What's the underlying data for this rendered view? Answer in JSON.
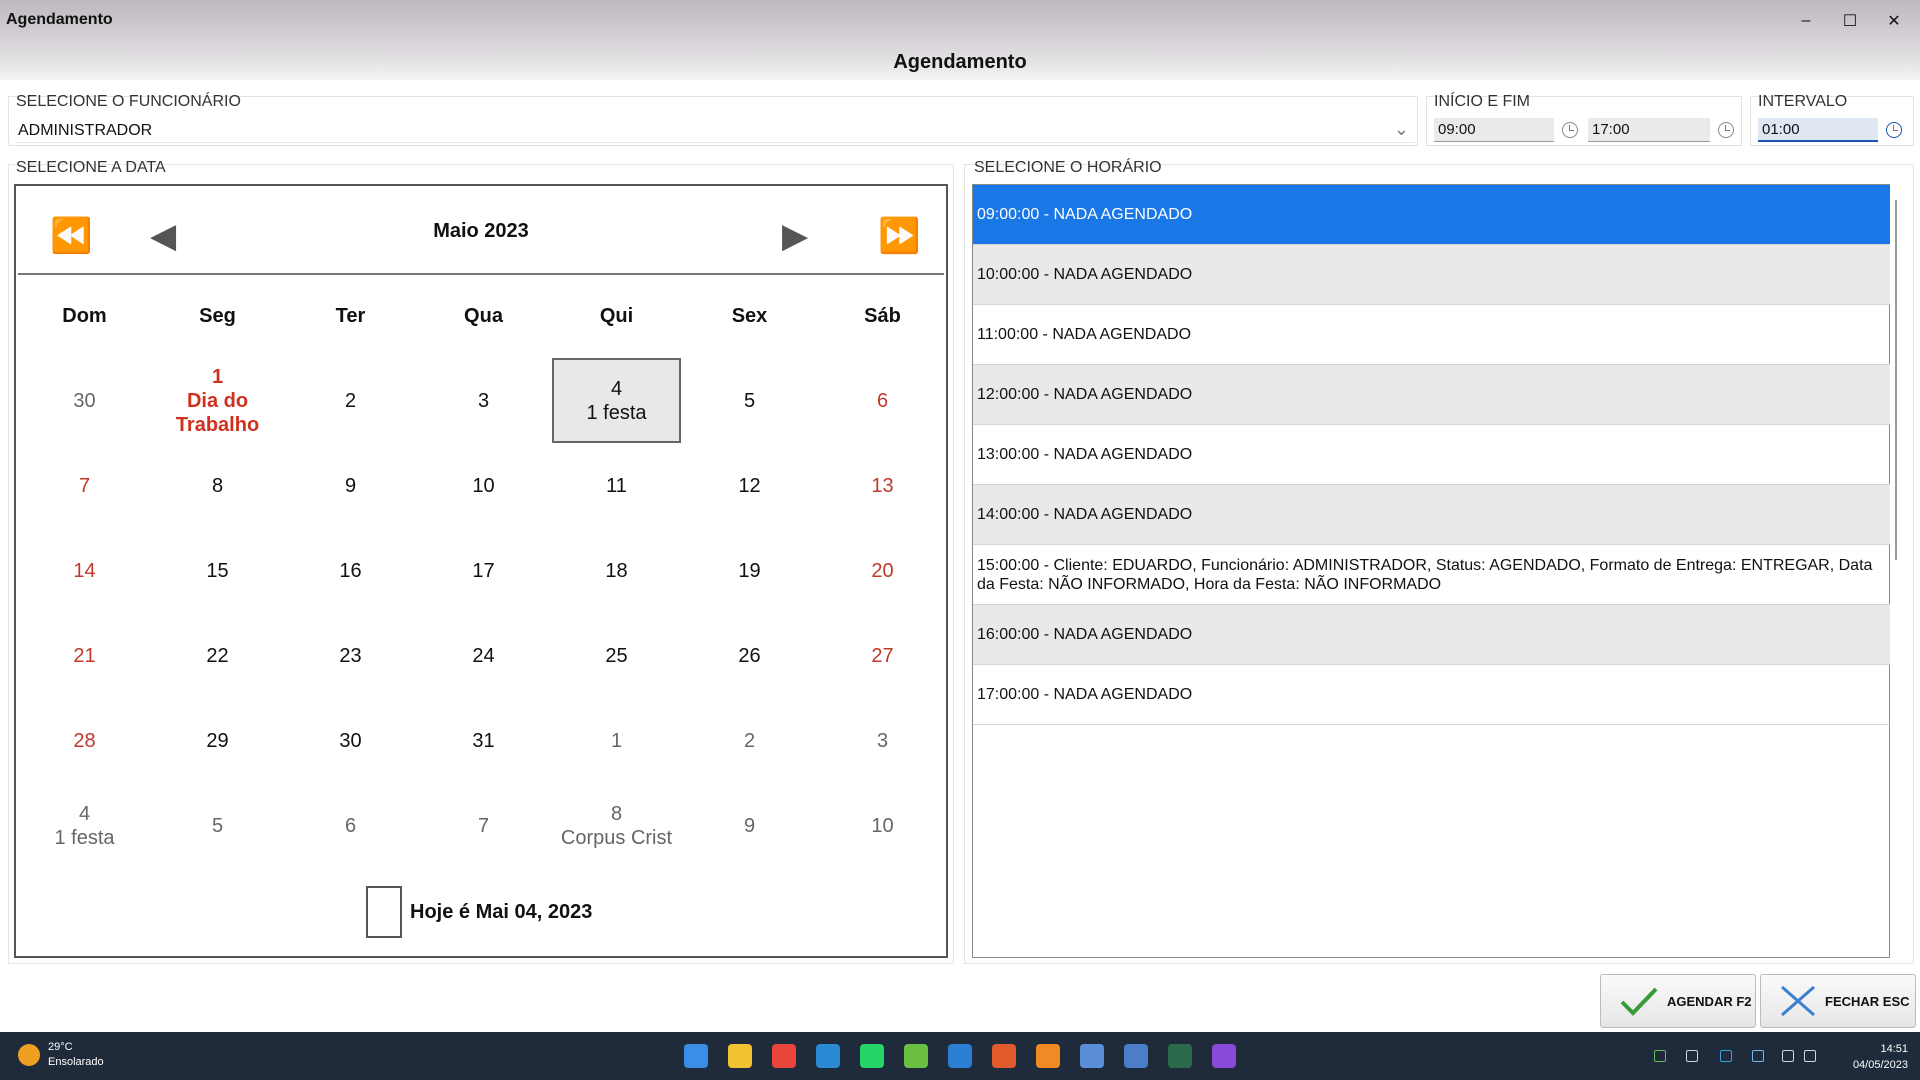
{
  "window": {
    "title": "Agendamento",
    "header_title": "Agendamento",
    "minimize_glyph": "–",
    "maximize_glyph": "☐",
    "close_glyph": "✕"
  },
  "employee": {
    "label": "SELECIONE O FUNCIONÁRIO",
    "value": "ADMINISTRADOR"
  },
  "start_end": {
    "label": "INÍCIO E FIM",
    "start": "09:00",
    "end": "17:00"
  },
  "interval": {
    "label": "INTERVALO",
    "value": "01:00"
  },
  "date_section": {
    "label": "SELECIONE A DATA"
  },
  "hour_section": {
    "label": "SELECIONE O HORÁRIO"
  },
  "calendar": {
    "month_title": "Maio 2023",
    "nav": {
      "prev_year": "⏪",
      "prev_month": "◀",
      "next_month": "▶",
      "next_year": "⏩"
    },
    "weekdays": [
      "Dom",
      "Seg",
      "Ter",
      "Qua",
      "Qui",
      "Sex",
      "Sáb"
    ],
    "weeks": [
      [
        {
          "day": "30",
          "note": "",
          "kind": "other"
        },
        {
          "day": "1",
          "note": "Dia do Trabalho",
          "kind": "holiday"
        },
        {
          "day": "2",
          "note": "",
          "kind": "normal"
        },
        {
          "day": "3",
          "note": "",
          "kind": "normal"
        },
        {
          "day": "4",
          "note": "1 festa",
          "kind": "selected"
        },
        {
          "day": "5",
          "note": "",
          "kind": "normal"
        },
        {
          "day": "6",
          "note": "",
          "kind": "red"
        }
      ],
      [
        {
          "day": "7",
          "note": "",
          "kind": "red"
        },
        {
          "day": "8",
          "note": "",
          "kind": "normal"
        },
        {
          "day": "9",
          "note": "",
          "kind": "normal"
        },
        {
          "day": "10",
          "note": "",
          "kind": "normal"
        },
        {
          "day": "11",
          "note": "",
          "kind": "normal"
        },
        {
          "day": "12",
          "note": "",
          "kind": "normal"
        },
        {
          "day": "13",
          "note": "",
          "kind": "red"
        }
      ],
      [
        {
          "day": "14",
          "note": "",
          "kind": "red"
        },
        {
          "day": "15",
          "note": "",
          "kind": "normal"
        },
        {
          "day": "16",
          "note": "",
          "kind": "normal"
        },
        {
          "day": "17",
          "note": "",
          "kind": "normal"
        },
        {
          "day": "18",
          "note": "",
          "kind": "normal"
        },
        {
          "day": "19",
          "note": "",
          "kind": "normal"
        },
        {
          "day": "20",
          "note": "",
          "kind": "red"
        }
      ],
      [
        {
          "day": "21",
          "note": "",
          "kind": "red"
        },
        {
          "day": "22",
          "note": "",
          "kind": "normal"
        },
        {
          "day": "23",
          "note": "",
          "kind": "normal"
        },
        {
          "day": "24",
          "note": "",
          "kind": "normal"
        },
        {
          "day": "25",
          "note": "",
          "kind": "normal"
        },
        {
          "day": "26",
          "note": "",
          "kind": "normal"
        },
        {
          "day": "27",
          "note": "",
          "kind": "red"
        }
      ],
      [
        {
          "day": "28",
          "note": "",
          "kind": "red"
        },
        {
          "day": "29",
          "note": "",
          "kind": "normal"
        },
        {
          "day": "30",
          "note": "",
          "kind": "normal"
        },
        {
          "day": "31",
          "note": "",
          "kind": "normal"
        },
        {
          "day": "1",
          "note": "",
          "kind": "other"
        },
        {
          "day": "2",
          "note": "",
          "kind": "other"
        },
        {
          "day": "3",
          "note": "",
          "kind": "other"
        }
      ],
      [
        {
          "day": "4",
          "note": "1 festa",
          "kind": "other"
        },
        {
          "day": "5",
          "note": "",
          "kind": "other"
        },
        {
          "day": "6",
          "note": "",
          "kind": "other"
        },
        {
          "day": "7",
          "note": "",
          "kind": "other"
        },
        {
          "day": "8",
          "note": "Corpus Crist",
          "kind": "other"
        },
        {
          "day": "9",
          "note": "",
          "kind": "other"
        },
        {
          "day": "10",
          "note": "",
          "kind": "other"
        }
      ]
    ],
    "today_text": "Hoje é Mai 04, 2023"
  },
  "hours": [
    {
      "text": "09:00:00 - NADA AGENDADO",
      "state": "selected"
    },
    {
      "text": "10:00:00 - NADA AGENDADO",
      "state": "alt"
    },
    {
      "text": "11:00:00 - NADA AGENDADO",
      "state": ""
    },
    {
      "text": "12:00:00 - NADA AGENDADO",
      "state": "alt"
    },
    {
      "text": "13:00:00 - NADA AGENDADO",
      "state": ""
    },
    {
      "text": "14:00:00 - NADA AGENDADO",
      "state": "alt"
    },
    {
      "text": "15:00:00 - Cliente: EDUARDO, Funcionário: ADMINISTRADOR, Status: AGENDADO, Formato de Entrega: ENTREGAR, Data da Festa: NÃO INFORMADO, Hora da Festa: NÃO INFORMADO",
      "state": ""
    },
    {
      "text": "16:00:00 - NADA AGENDADO",
      "state": "alt"
    },
    {
      "text": "17:00:00 - NADA AGENDADO",
      "state": ""
    }
  ],
  "actions": {
    "schedule_label": "AGENDAR F2",
    "close_label": "FECHAR ESC"
  },
  "taskbar": {
    "weather_temp": "29°C",
    "weather_desc": "Ensolarado",
    "time": "14:51",
    "date": "04/05/2023",
    "apps": [
      "windows-start-icon",
      "file-explorer-icon",
      "chrome-icon",
      "edge-icon",
      "whatsapp-icon",
      "spreadsheet-icon",
      "app-blue-icon",
      "app-red-icon",
      "firefox-icon",
      "settings-icon",
      "notepad-icon",
      "active-app-icon",
      "media-icon"
    ]
  },
  "colors": {
    "selection_blue": "#1978e6",
    "weekend_red": "#c0392b",
    "holiday_red": "#d0301d"
  }
}
